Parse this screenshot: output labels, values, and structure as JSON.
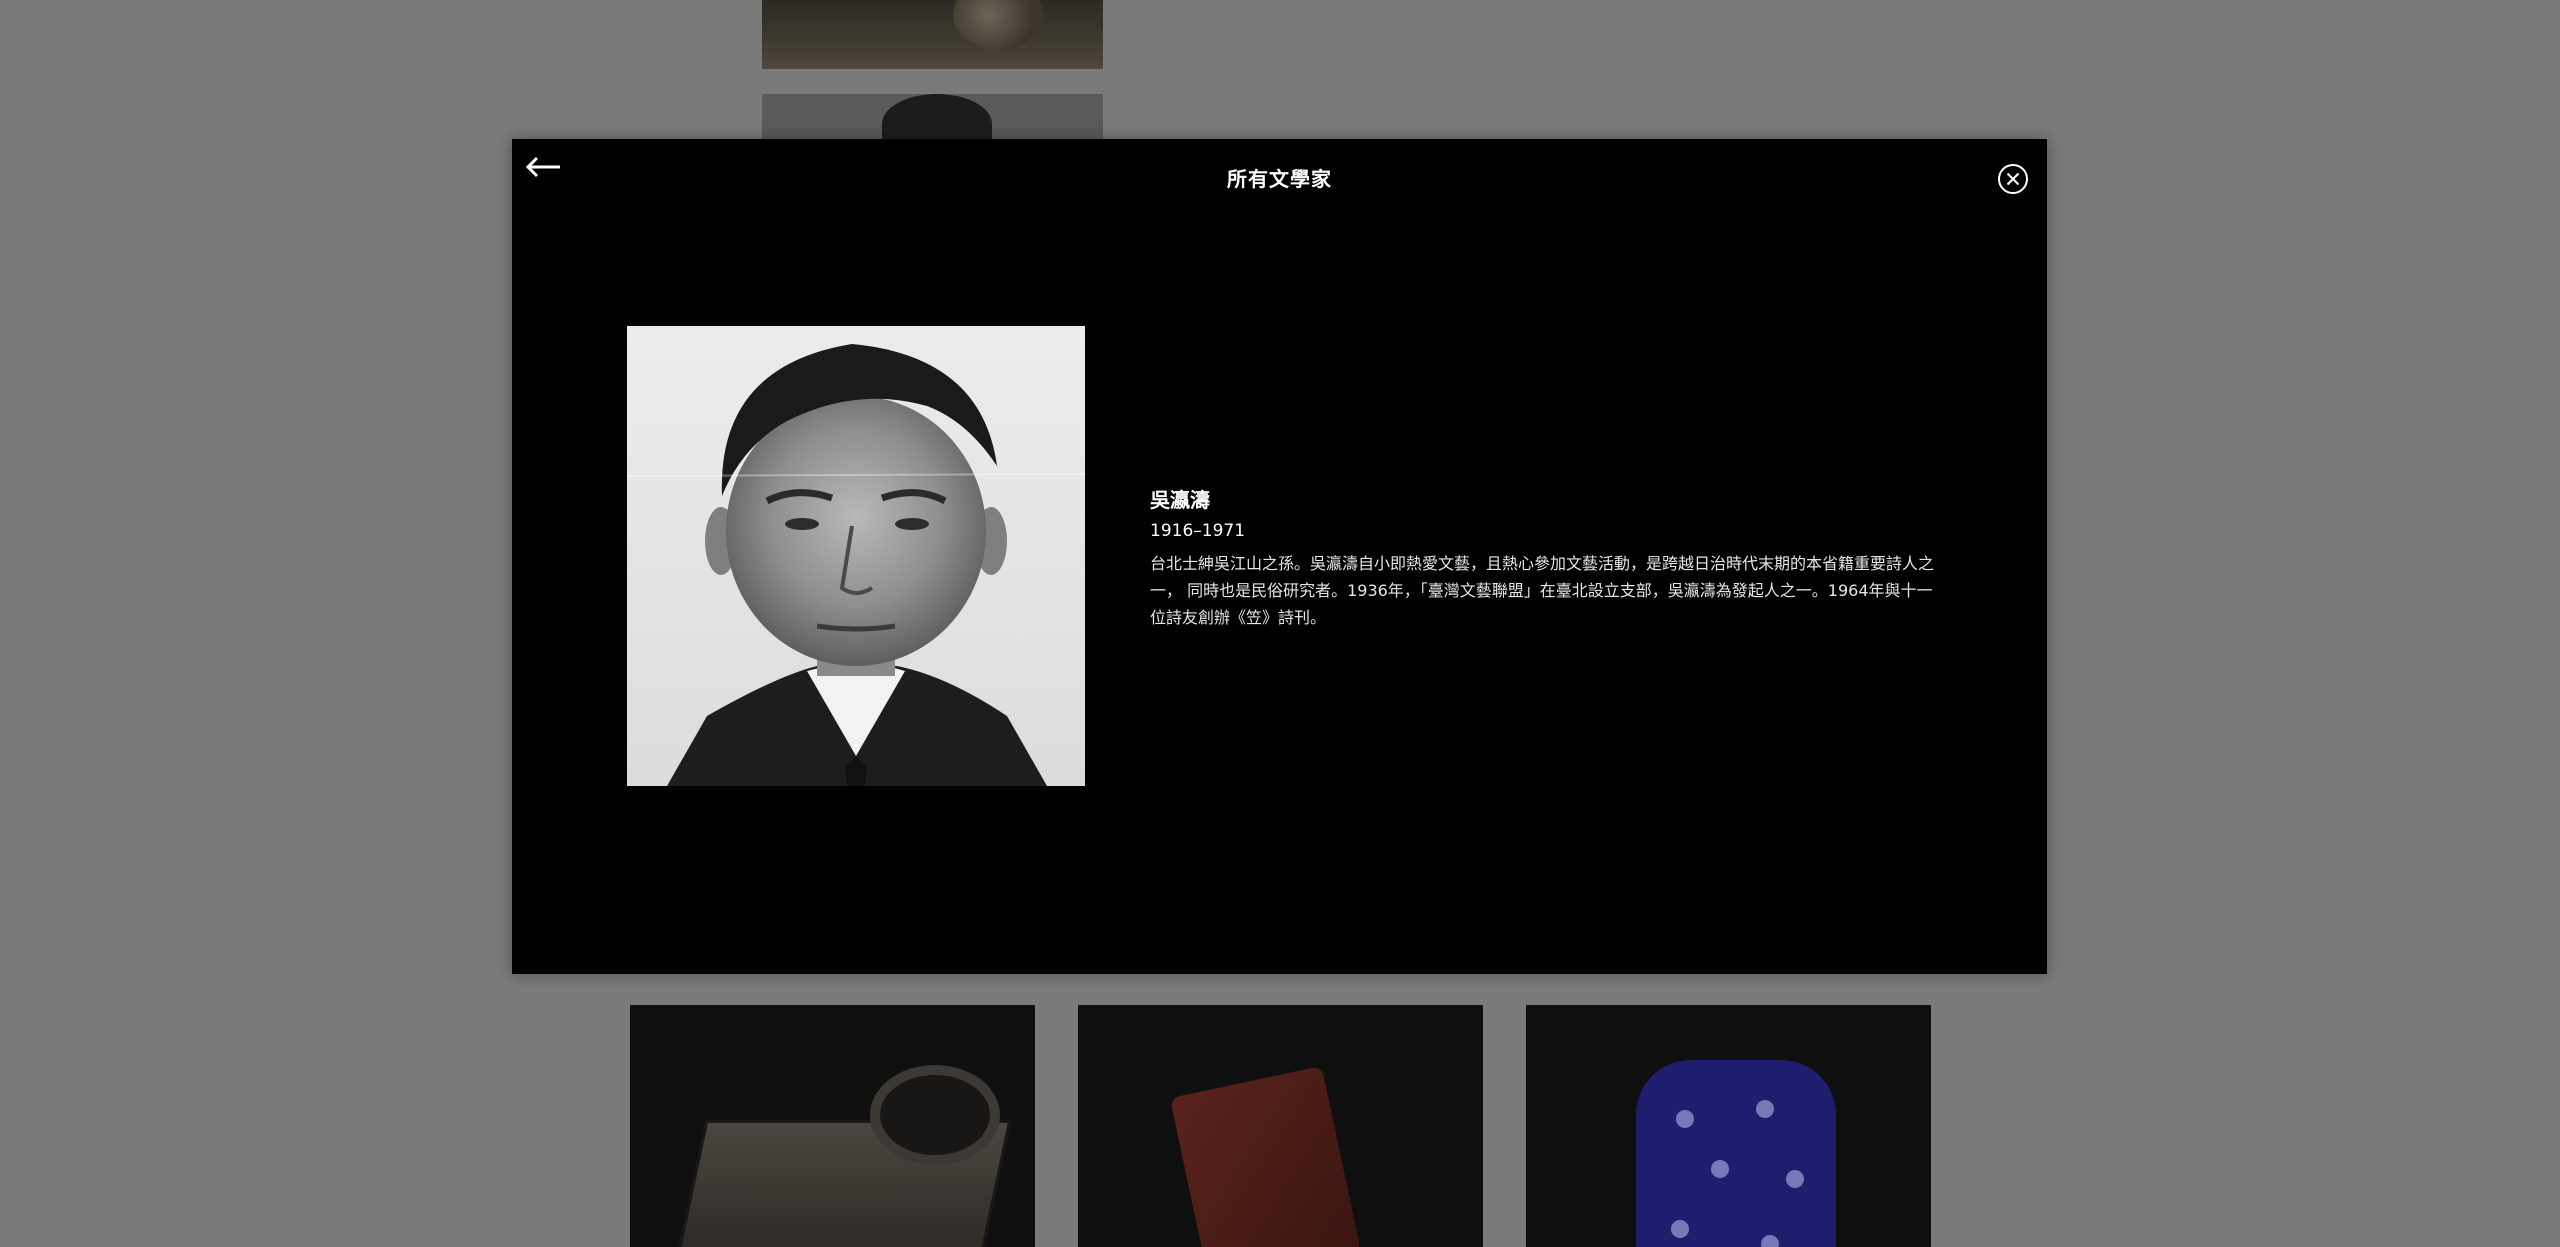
{
  "modal": {
    "title": "所有文學家",
    "back_icon": "arrow-left-icon",
    "close_icon": "close-circle-icon"
  },
  "writer": {
    "name": "吳瀛濤",
    "years": "1916–1971",
    "bio": "台北士紳吳江山之孫。吳瀛濤自小即熱愛文藝，且熱心參加文藝活動，是跨越日治時代末期的本省籍重要詩人之一， 同時也是民俗研究者。1936年，「臺灣文藝聯盟」在臺北設立支部，吳瀛濤為發起人之一。1964年與十一位詩友創辦《笠》詩刊。"
  },
  "background": {
    "gallery_items": [
      "writer-portrait",
      "writer-portrait",
      "inkstone-object",
      "seal-object",
      "vest-object"
    ]
  },
  "colors": {
    "backdrop": "#7a7a7a",
    "modal_bg": "#000000",
    "text": "#ffffff"
  }
}
